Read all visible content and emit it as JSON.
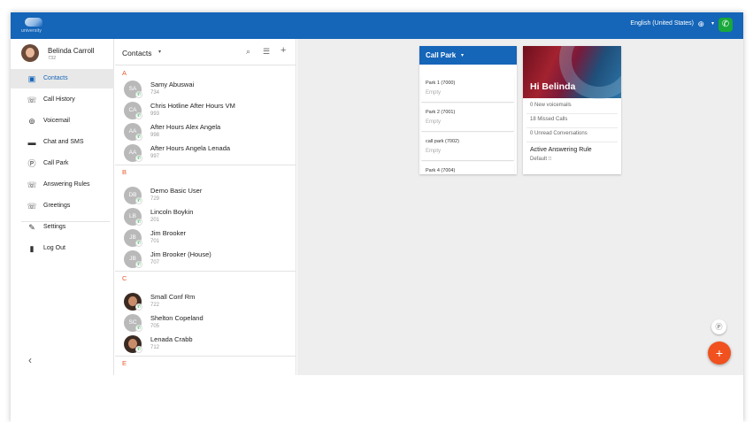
{
  "topbar": {
    "logo_text": "university",
    "language": "English (United States)",
    "globe_icon": "globe-icon",
    "caret": "▾",
    "call_icon": "phone-icon"
  },
  "user": {
    "name": "Belinda Carroll",
    "extension": "732"
  },
  "sidebar": {
    "items": [
      {
        "label": "Contacts",
        "icon": "▣"
      },
      {
        "label": "Call History",
        "icon": "☏"
      },
      {
        "label": "Voicemail",
        "icon": "⊚"
      },
      {
        "label": "Chat and SMS",
        "icon": "▬"
      },
      {
        "label": "Call Park",
        "icon": "Ⓟ"
      },
      {
        "label": "Answering Rules",
        "icon": "☏"
      },
      {
        "label": "Greetings",
        "icon": "☏"
      },
      {
        "label": "Settings",
        "icon": "✎"
      },
      {
        "label": "Log Out",
        "icon": "▮"
      }
    ],
    "collapse": "‹"
  },
  "contacts": {
    "title": "Contacts",
    "caret": "▾",
    "search": "⌕",
    "filter": "☰",
    "add": "+",
    "sections": [
      {
        "letter": "A",
        "rows": [
          {
            "initials": "SA",
            "name": "Samy Abuswai",
            "ext": "734"
          },
          {
            "initials": "CA",
            "name": "Chris Hotline After Hours VM",
            "ext": "993"
          },
          {
            "initials": "AA",
            "name": "After Hours Alex Angela",
            "ext": "998"
          },
          {
            "initials": "AA",
            "name": "After Hours Angela Lenada",
            "ext": "997"
          }
        ]
      },
      {
        "letter": "B",
        "rows": [
          {
            "initials": "DB",
            "name": "Demo Basic User",
            "ext": "729"
          },
          {
            "initials": "LB",
            "name": "Lincoln Boykin",
            "ext": "201"
          },
          {
            "initials": "JB",
            "name": "Jim Brooker",
            "ext": "701"
          },
          {
            "initials": "JB",
            "name": "Jim Brooker (House)",
            "ext": "707"
          }
        ]
      },
      {
        "letter": "C",
        "rows": [
          {
            "initials": "",
            "name": "Small Conf Rm",
            "ext": "722"
          },
          {
            "initials": "SC",
            "name": "Shelton Copeland",
            "ext": "705"
          },
          {
            "initials": "",
            "name": "Lenada Crabb",
            "ext": "712"
          }
        ]
      },
      {
        "letter": "E",
        "rows": []
      }
    ]
  },
  "callpark": {
    "title": "Call Park",
    "caret": "▾",
    "parks": [
      {
        "name": "Park 1 (7000)",
        "status": "Empty"
      },
      {
        "name": "Park 2 (7001)",
        "status": "Empty"
      },
      {
        "name": "call park (7002)",
        "status": "Empty"
      },
      {
        "name": "Park 4 (7004)",
        "status": ""
      }
    ]
  },
  "greeting": {
    "title": "Hi Belinda",
    "voicemails": "0 New voicemails",
    "missed": "18 Missed Calls",
    "conversations": "0 Unread Conversations",
    "rule_label": "Active Answering Rule",
    "rule_value": "Default ⁝⁝"
  },
  "fab": {
    "park": "Ⓟ",
    "add": "+"
  }
}
